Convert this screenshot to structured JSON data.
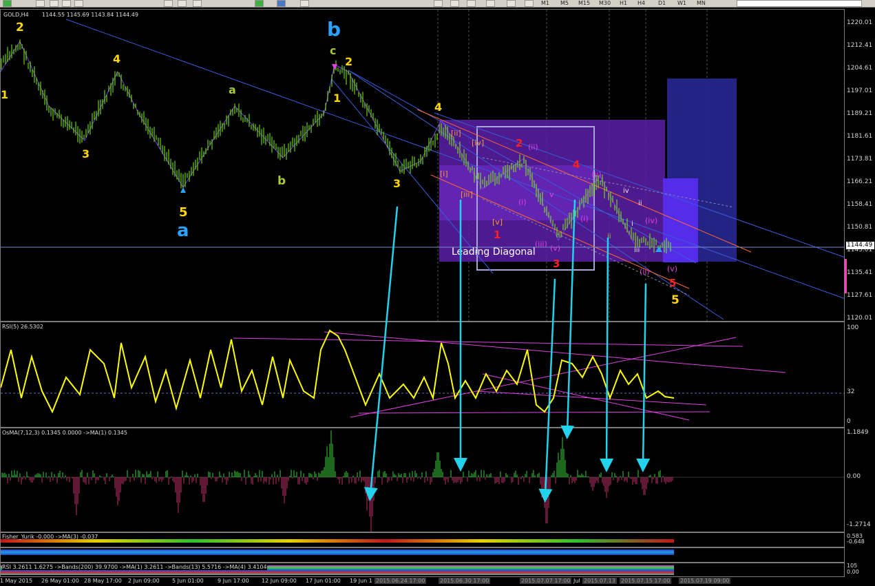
{
  "toolbar": {
    "timeframes": [
      "M1",
      "M5",
      "M15",
      "M30",
      "H1",
      "H4",
      "D1",
      "W1",
      "MN"
    ]
  },
  "main_chart": {
    "title": "GOLD,H4",
    "ohlc": "1144.55 1145.69 1143.84 1144.49",
    "current_price": "1144.49",
    "price_scale": [
      "1220.01",
      "1212.41",
      "1204.61",
      "1197.01",
      "1189.21",
      "1181.61",
      "1173.81",
      "1166.21",
      "1158.41",
      "1150.81",
      "1143.01",
      "1135.41",
      "1127.61",
      "1120.01"
    ],
    "annotation": "Leading Diagonal"
  },
  "rsi": {
    "label": "RSI(5) 26.5302",
    "scale": [
      "100",
      "32",
      "0"
    ]
  },
  "osma": {
    "label": "OsMA(7,12,3) 0.1345 0.0000 ->MA(1) 0.1345",
    "scale": [
      "1.1849",
      "0.00",
      "-1.2714"
    ]
  },
  "fisher": {
    "label": "Fisher_Yurik -0.000 ->MA(3) -0.037",
    "scale": [
      "0.583",
      "-0.648"
    ]
  },
  "bottom": {
    "label": "RSI 3.2611 1.6275 ->Bands(200) 39.9700 ->MA(1) 3.2611 ->Bands(13) 5.5716 ->MA(4) 3.4104",
    "scale": [
      "105",
      "0.00"
    ]
  },
  "time_axis": [
    "1 May 2015",
    "26 May 01:00",
    "28 May 17:00",
    "2 Jun 09:00",
    "5 Jun 01:00",
    "9 Jun 17:00",
    "12 Jun 09:00",
    "17 Jun 01:00",
    "19 Jun 1",
    "2015.06.24 17:00",
    "2015.06.30 17:00",
    "2015.07.07 17:00",
    "Jul",
    "2015.07.13",
    "2015.07.15 17:00",
    "2015.07.19 09:00"
  ],
  "wave_labels": [
    {
      "text": "2",
      "color": "#ffd700"
    },
    {
      "text": "1",
      "color": "#ffd700"
    },
    {
      "text": "4",
      "color": "#ffd700"
    },
    {
      "text": "3",
      "color": "#ffd700"
    },
    {
      "text": "5",
      "color": "#ffd700"
    },
    {
      "text": "a",
      "color": "#29a3ff"
    },
    {
      "text": "a",
      "color": "#a8c838"
    },
    {
      "text": "b",
      "color": "#a8c838"
    },
    {
      "text": "b",
      "color": "#29a3ff"
    },
    {
      "text": "c",
      "color": "#a8c838"
    },
    {
      "text": "2",
      "color": "#ffd700"
    },
    {
      "text": "1",
      "color": "#ffd700"
    },
    {
      "text": "3",
      "color": "#ffd700"
    },
    {
      "text": "4",
      "color": "#ffd700"
    },
    {
      "text": "[i]",
      "color": "#ff9b2e"
    },
    {
      "text": "[ii]",
      "color": "#ff9b2e"
    },
    {
      "text": "[iii]",
      "color": "#ff9b2e"
    },
    {
      "text": "[iv]",
      "color": "#ff9b2e"
    },
    {
      "text": "[v]",
      "color": "#ff9b2e"
    },
    {
      "text": "1",
      "color": "#ff2020"
    },
    {
      "text": "2",
      "color": "#ff2020"
    },
    {
      "text": "3",
      "color": "#ff2020"
    },
    {
      "text": "4",
      "color": "#ff2020"
    },
    {
      "text": "5",
      "color": "#ff2020"
    },
    {
      "text": "(ii)",
      "color": "#e040e0"
    },
    {
      "text": "(i)",
      "color": "#e040e0"
    },
    {
      "text": "(iii)",
      "color": "#e040e0"
    },
    {
      "text": "(v)",
      "color": "#e040e0"
    },
    {
      "text": "(ii)",
      "color": "#e040e0"
    },
    {
      "text": "(i)",
      "color": "#e040e0"
    },
    {
      "text": "(iv)",
      "color": "#e040e0"
    },
    {
      "text": "(ii)",
      "color": "#e040e0"
    },
    {
      "text": "(v)",
      "color": "#e040e0"
    },
    {
      "text": "iv",
      "color": "#e8e8e8"
    },
    {
      "text": "ii",
      "color": "#e8e8e8"
    },
    {
      "text": "iii",
      "color": "#e8e8e8"
    },
    {
      "text": "i",
      "color": "#e8e8e8"
    },
    {
      "text": "ii",
      "color": "#a8c838"
    },
    {
      "text": "v",
      "color": "#e040e0"
    },
    {
      "text": "5",
      "color": "#ffd700"
    }
  ],
  "colors": {
    "candles": "#7cfc00",
    "rsi_line": "#ffff00",
    "trendline": "#3b5bdb",
    "zigzag": "#7b3fe4",
    "arrow": "#22d3ee",
    "box_fill": "#5b1fa8",
    "box_blue": "#2a2a8a"
  }
}
